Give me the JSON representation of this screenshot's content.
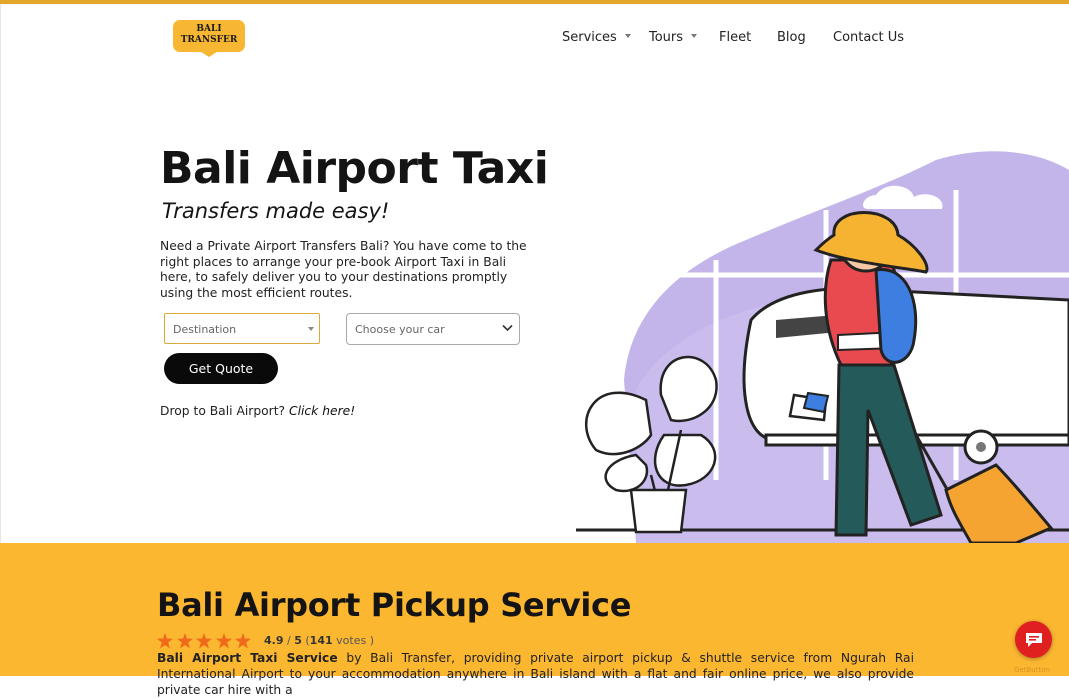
{
  "header": {
    "logo_line1": "BALI",
    "logo_line2": "TRANSFER",
    "nav": [
      {
        "label": "Services",
        "has_dropdown": true
      },
      {
        "label": "Tours",
        "has_dropdown": true
      },
      {
        "label": "Fleet",
        "has_dropdown": false
      },
      {
        "label": "Blog",
        "has_dropdown": false
      },
      {
        "label": "Contact Us",
        "has_dropdown": false
      }
    ]
  },
  "hero": {
    "title": "Bali Airport Taxi",
    "subtitle": "Transfers made easy!",
    "description": "Need a Private Airport Transfers Bali? You have come to the right places to arrange your pre-book Airport Taxi in Bali here, to safely deliver you to your destinations promptly using the most efficient routes.",
    "destination_select": "Destination",
    "car_select": "Choose your car",
    "quote_button": "Get Quote",
    "drop_text": "Drop to Bali Airport?",
    "drop_link": "Click here!"
  },
  "pickup": {
    "title": "Bali Airport Pickup Service",
    "stars": 5,
    "rating_value": "4.9",
    "rating_sep": "/",
    "rating_max": "5",
    "rating_open": "(",
    "votes_count": "141",
    "votes_label": "votes",
    "rating_close": ")",
    "desc_bold": "Bali Airport Taxi Service",
    "desc_rest": " by Bali Transfer, providing private airport pickup & shuttle service from Ngurah Rai International Airport to your accommodation anywhere in Bali island with a flat and fair online price, we also provide private car hire with a"
  },
  "widget": {
    "brand": "GetButton"
  },
  "colors": {
    "accent": "#fcb731",
    "top_line": "#e3a82b",
    "illustration_purple": "#b9a8e6",
    "chat_red": "#e02020",
    "star": "#f06a1c"
  },
  "icons": {
    "nav_caret": "chevron-down-icon",
    "car_select": "chevron-down-icon",
    "chat": "chat-bubble-icon",
    "rating": "star-icon"
  }
}
